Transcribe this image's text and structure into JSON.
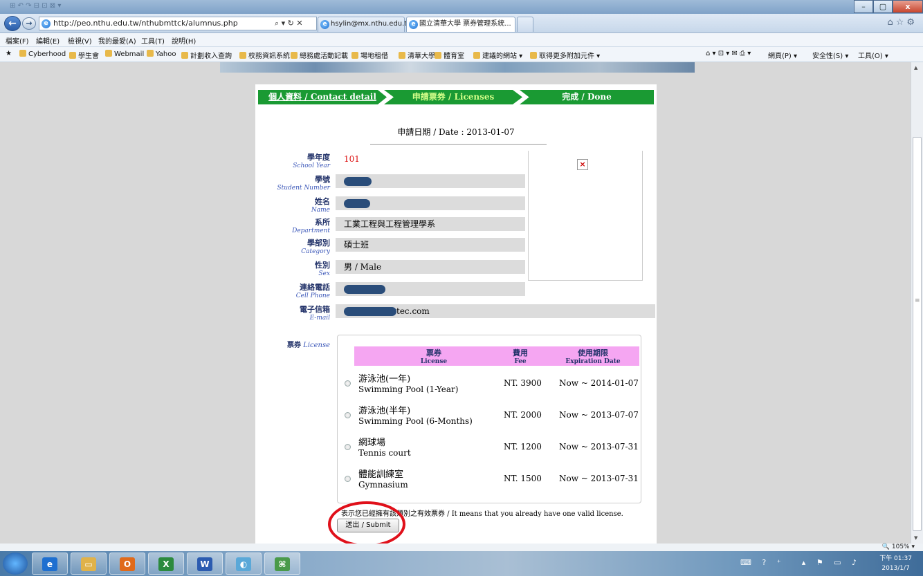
{
  "browser": {
    "address_url": "http://peo.nthu.edu.tw/nthubmttck/alumnus.php",
    "address_tools": "⌕ ▾ ↻ ✕",
    "tabs": [
      "hsylin@mx.nthu.edu.tw",
      "國立清華大學 票券管理系統..."
    ],
    "new_tab": "",
    "window_buttons": [
      "–",
      "▢",
      "x"
    ]
  },
  "menu": [
    "檔案(F)",
    "編輯(E)",
    "檢視(V)",
    "我的最愛(A)",
    "工具(T)",
    "說明(H)"
  ],
  "favorites": [
    "Cyberhood",
    "學生會",
    "Webmail",
    "Yahoo",
    "計劃收入查詢",
    "校務資訊系統",
    "總務處活動記載",
    "場地租借",
    "清華大學",
    "體育室",
    "建議的網站 ▾",
    "取得更多附加元件 ▾"
  ],
  "favbar_right": [
    "網頁(P) ▾",
    "安全性(S) ▾",
    "工具(O) ▾"
  ],
  "steps": [
    "個人資料 / Contact detail",
    "申請票券 / Licenses",
    "完成 / Done"
  ],
  "apply_date": "申請日期 / Date : 2013-01-07",
  "form": {
    "school_year": {
      "zh": "學年度",
      "en": "School Year",
      "value": "101"
    },
    "student_number": {
      "zh": "學號",
      "en": "Student Number"
    },
    "name": {
      "zh": "姓名",
      "en": "Name"
    },
    "department": {
      "zh": "系所",
      "en": "Department",
      "value": "工業工程與工程管理學系"
    },
    "category": {
      "zh": "學部別",
      "en": "Category",
      "value": "碩士班"
    },
    "sex": {
      "zh": "性別",
      "en": "Sex",
      "value": "男 / Male"
    },
    "phone": {
      "zh": "連絡電話",
      "en": "Cell Phone"
    },
    "email": {
      "zh": "電子信箱",
      "en": "E-mail",
      "value": "tec.com"
    }
  },
  "license": {
    "label_zh": "票券",
    "label_en": "License",
    "headers": {
      "license": {
        "zh": "票券",
        "en": "License"
      },
      "fee": {
        "zh": "費用",
        "en": "Fee"
      },
      "expiration": {
        "zh": "使用期限",
        "en": "Expiration Date"
      }
    },
    "rows": [
      {
        "zh": "游泳池(一年)",
        "en": "Swimming Pool (1-Year)",
        "fee": "NT. 3900",
        "exp": "Now ~ 2014-01-07"
      },
      {
        "zh": "游泳池(半年)",
        "en": "Swimming Pool (6-Months)",
        "fee": "NT. 2000",
        "exp": "Now ~ 2013-07-07"
      },
      {
        "zh": "網球場",
        "en": "Tennis court",
        "fee": "NT. 1200",
        "exp": "Now ~ 2013-07-31"
      },
      {
        "zh": "體能訓練室",
        "en": "Gymnasium",
        "fee": "NT. 1500",
        "exp": "Now ~ 2013-07-31"
      }
    ]
  },
  "note": "表示您已經擁有該類別之有效票券 / It means that you already have one valid license.",
  "submit_label": "送出 / Submit",
  "status": {
    "zoom": "105%"
  },
  "clock": {
    "time": "下午 01:37",
    "date": "2013/1/7"
  },
  "colors": {
    "step_green": "#1a9a33",
    "license_header": "#f5a6f2",
    "annotation": "#e0101a",
    "label_blue": "#3a56b8"
  }
}
